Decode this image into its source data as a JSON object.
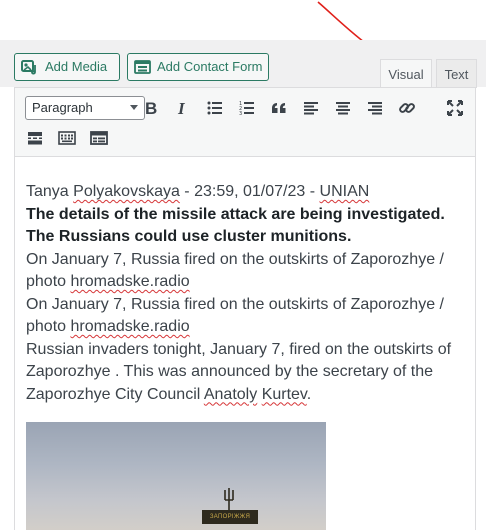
{
  "media_bar": {
    "add_media_label": "Add Media",
    "add_contact_form_label": "Add Contact Form"
  },
  "tabs": {
    "visual": "Visual",
    "text": "Text",
    "active": "visual"
  },
  "toolbar": {
    "format_select": "Paragraph",
    "row1_icons": [
      "bold-icon",
      "italic-icon",
      "bulleted-list-icon",
      "numbered-list-icon",
      "blockquote-icon",
      "align-left-icon",
      "align-center-icon",
      "align-right-icon",
      "link-icon",
      "fullscreen-icon"
    ],
    "row2_icons": [
      "read-more-icon",
      "toolbar-toggle-icon",
      "contact-form-icon"
    ]
  },
  "content": {
    "byline": {
      "pre": "Tanya ",
      "name": "Polyakovskaya",
      "mid": " - 23:59, 01/07/23 - ",
      "source": "UNIAN"
    },
    "headline": "The details of the missile attack are being investigated. The Russians could use cluster munitions.",
    "caption1": {
      "text": "On January 7, Russia fired on the outskirts of Zaporozhye / photo ",
      "credit": "hromadske.radio"
    },
    "caption2": {
      "text": "On January 7, Russia fired on the outskirts of Zaporozhye / photo ",
      "credit": "hromadske.radio"
    },
    "body": {
      "text": "Russian invaders tonight, January 7, fired on the outskirts of Zaporozhye . This was announced by the secretary of the Zaporozhye City Council ",
      "name_first": "Anatoly",
      "name_last": "Kurtev",
      "end": "."
    },
    "image_sign_text": "ЗАПОРІЖЖЯ"
  },
  "colors": {
    "accent": "#2b7a63",
    "annotation_arrow": "#e0201a",
    "spellcheck": "#d63638"
  }
}
